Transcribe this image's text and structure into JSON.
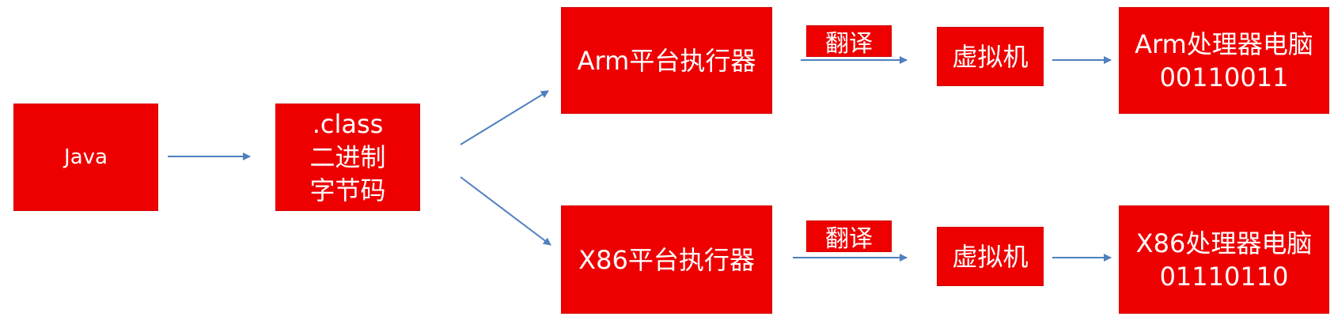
{
  "colors": {
    "box_fill": "#ee0000",
    "box_text": "#ffffff",
    "arrow": "#4f7fbf"
  },
  "nodes": {
    "java": {
      "label": "Java"
    },
    "bytecode": {
      "lines": [
        ".class",
        "二进制",
        "字节码"
      ]
    },
    "arm_executor": {
      "label": "Arm平台执行器"
    },
    "x86_executor": {
      "label": "X86平台执行器"
    },
    "arm_translate": {
      "label": "翻译"
    },
    "x86_translate": {
      "label": "翻译"
    },
    "arm_vm": {
      "label": "虚拟机"
    },
    "x86_vm": {
      "label": "虚拟机"
    },
    "arm_computer": {
      "lines": [
        "Arm处理器电脑",
        "00110011"
      ]
    },
    "x86_computer": {
      "lines": [
        "X86处理器电脑",
        "01110110"
      ]
    }
  }
}
